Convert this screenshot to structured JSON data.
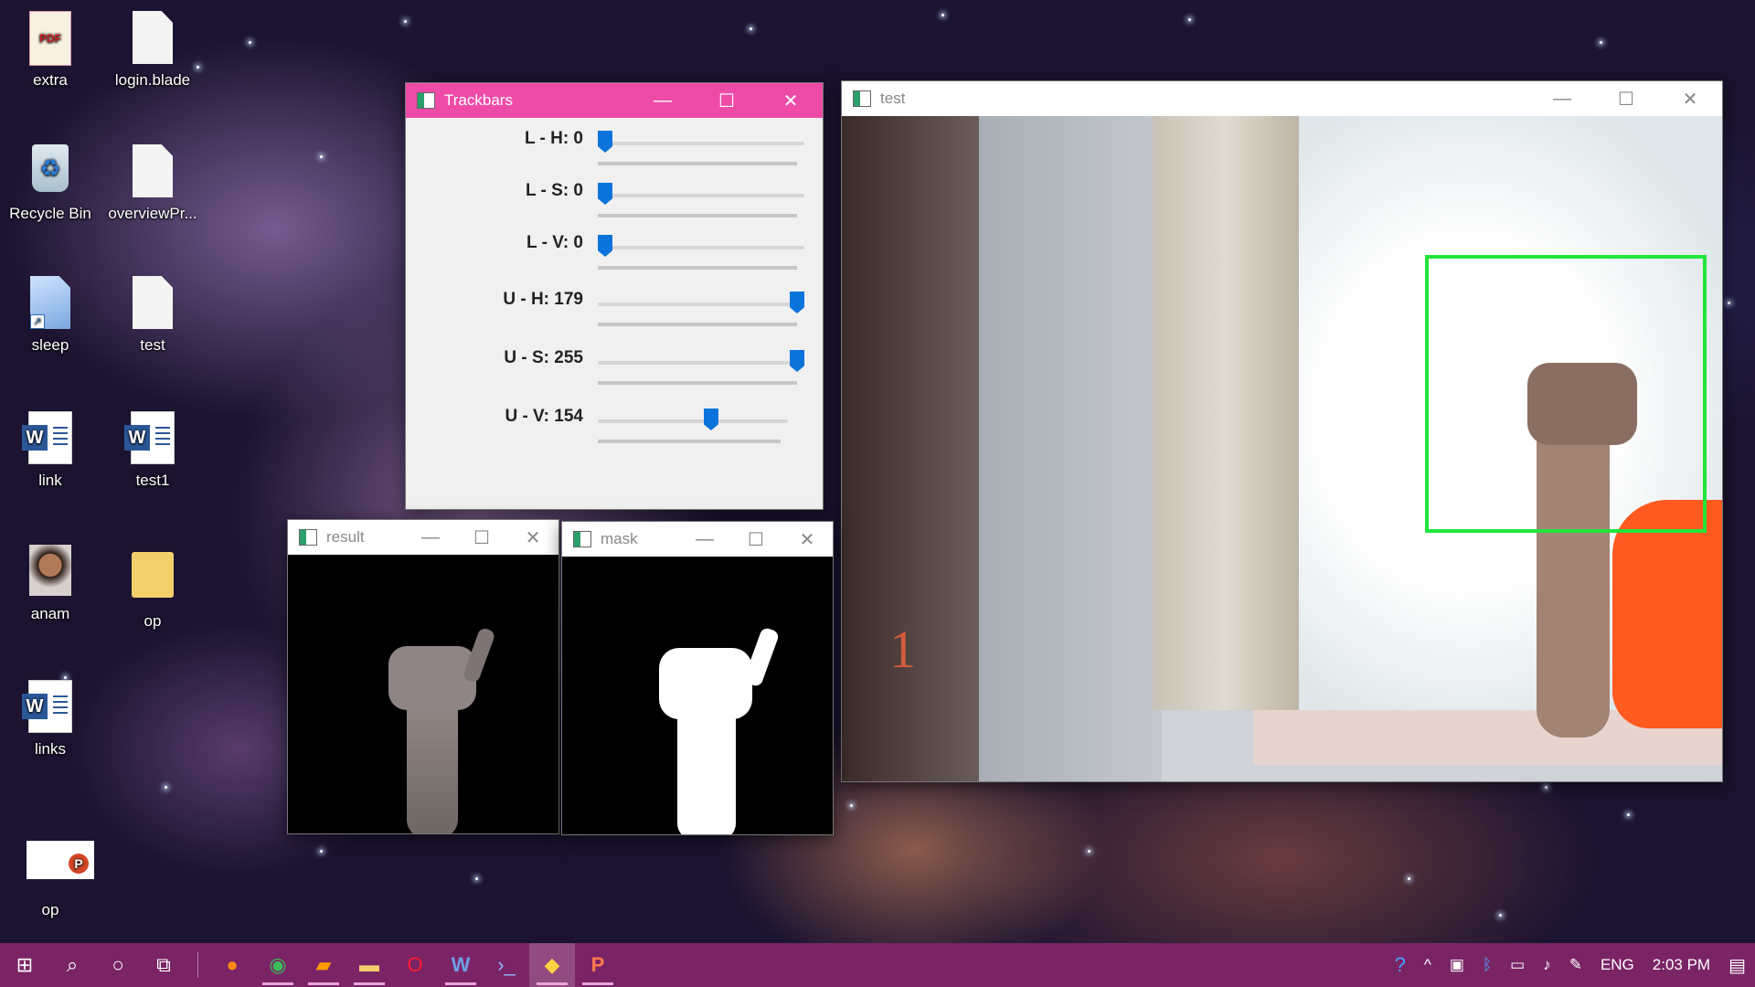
{
  "desktop": {
    "icons": [
      {
        "label": "extra",
        "type": "pdf"
      },
      {
        "label": "login.blade",
        "type": "doc"
      },
      {
        "label": "Recycle Bin",
        "type": "bin"
      },
      {
        "label": "overviewPr...",
        "type": "doc"
      },
      {
        "label": "sleep",
        "type": "shortcut"
      },
      {
        "label": "test",
        "type": "doc"
      },
      {
        "label": "link",
        "type": "word"
      },
      {
        "label": "test1",
        "type": "word"
      },
      {
        "label": "anam",
        "type": "user"
      },
      {
        "label": "op",
        "type": "folder"
      },
      {
        "label": "links",
        "type": "word"
      },
      {
        "label": "op",
        "type": "powerpoint"
      }
    ]
  },
  "trackbars_window": {
    "title": "Trackbars",
    "controls": [
      {
        "label": "L - H: 0",
        "value": 0,
        "max": 179
      },
      {
        "label": "L - S: 0",
        "value": 0,
        "max": 255
      },
      {
        "label": "L - V: 0",
        "value": 0,
        "max": 255
      },
      {
        "label": "U - H: 179",
        "value": 179,
        "max": 179
      },
      {
        "label": "U - S: 255",
        "value": 255,
        "max": 255
      },
      {
        "label": "U - V: 154",
        "value": 154,
        "max": 255
      }
    ]
  },
  "test_window": {
    "title": "test",
    "overlay_number": "1",
    "box_color": "#22e53a"
  },
  "result_window": {
    "title": "result"
  },
  "mask_window": {
    "title": "mask"
  },
  "window_buttons": {
    "minimize": "—",
    "maximize": "☐",
    "close": "✕"
  },
  "taskbar": {
    "apps": [
      "windows-start",
      "search",
      "cortana",
      "task-view",
      "firefox",
      "chrome",
      "sublime-text",
      "file-explorer",
      "opera",
      "word",
      "powershell",
      "python",
      "powerpoint"
    ],
    "language": "ENG",
    "time": "2:03 PM",
    "accent": "#7a2466"
  }
}
